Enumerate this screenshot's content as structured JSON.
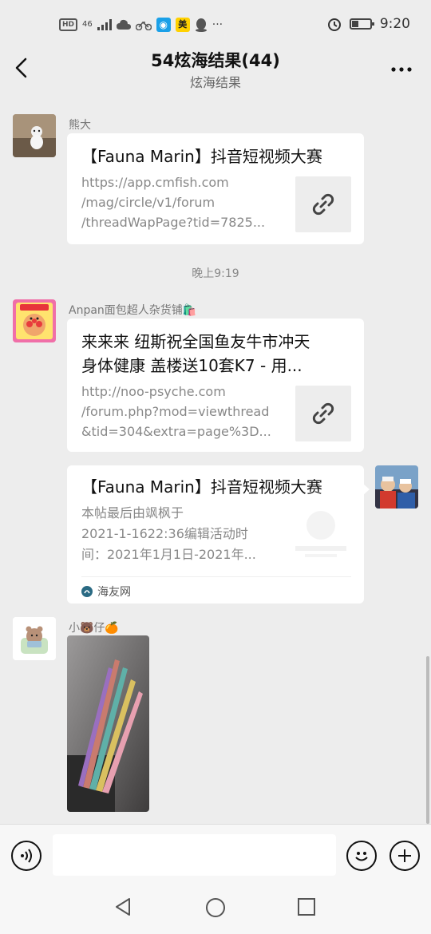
{
  "status": {
    "hd": "HD",
    "signal": "46",
    "time": "9:20",
    "mei": "美",
    "dots": "···"
  },
  "header": {
    "title": "54炫海结果(44)",
    "subtitle": "炫海结果"
  },
  "messages": [
    {
      "sender": "熊大",
      "title": "【Fauna Marin】抖音短视频大赛",
      "desc": [
        "https://app.cmfish.com",
        "/mag/circle/v1/forum",
        "/threadWapPage?tid=7825..."
      ]
    },
    {
      "time": "晚上9:19"
    },
    {
      "sender": "Anpan面包超人杂货铺🛍️",
      "title_lines": [
        "来来来 纽斯祝全国鱼友牛市冲天",
        "身体健康 盖楼送10套K7 - 用..."
      ],
      "desc": [
        "http://noo-psyche.com",
        "/forum.php?mod=viewthread",
        "&tid=304&extra=page%3D..."
      ]
    },
    {
      "title": "【Fauna Marin】抖音短视频大赛",
      "desc": [
        "本帖最后由飒枫于",
        "2021-1-1622:36编辑活动时",
        "间：2021年1月1日-2021年..."
      ],
      "source": "海友网"
    },
    {
      "sender": "小🐻仔🍊"
    }
  ],
  "icons": {
    "back": "chevron-left-icon",
    "more": "more-dots-icon",
    "link": "link-icon",
    "voice": "voice-icon",
    "emoji": "emoji-icon",
    "plus": "plus-icon"
  }
}
